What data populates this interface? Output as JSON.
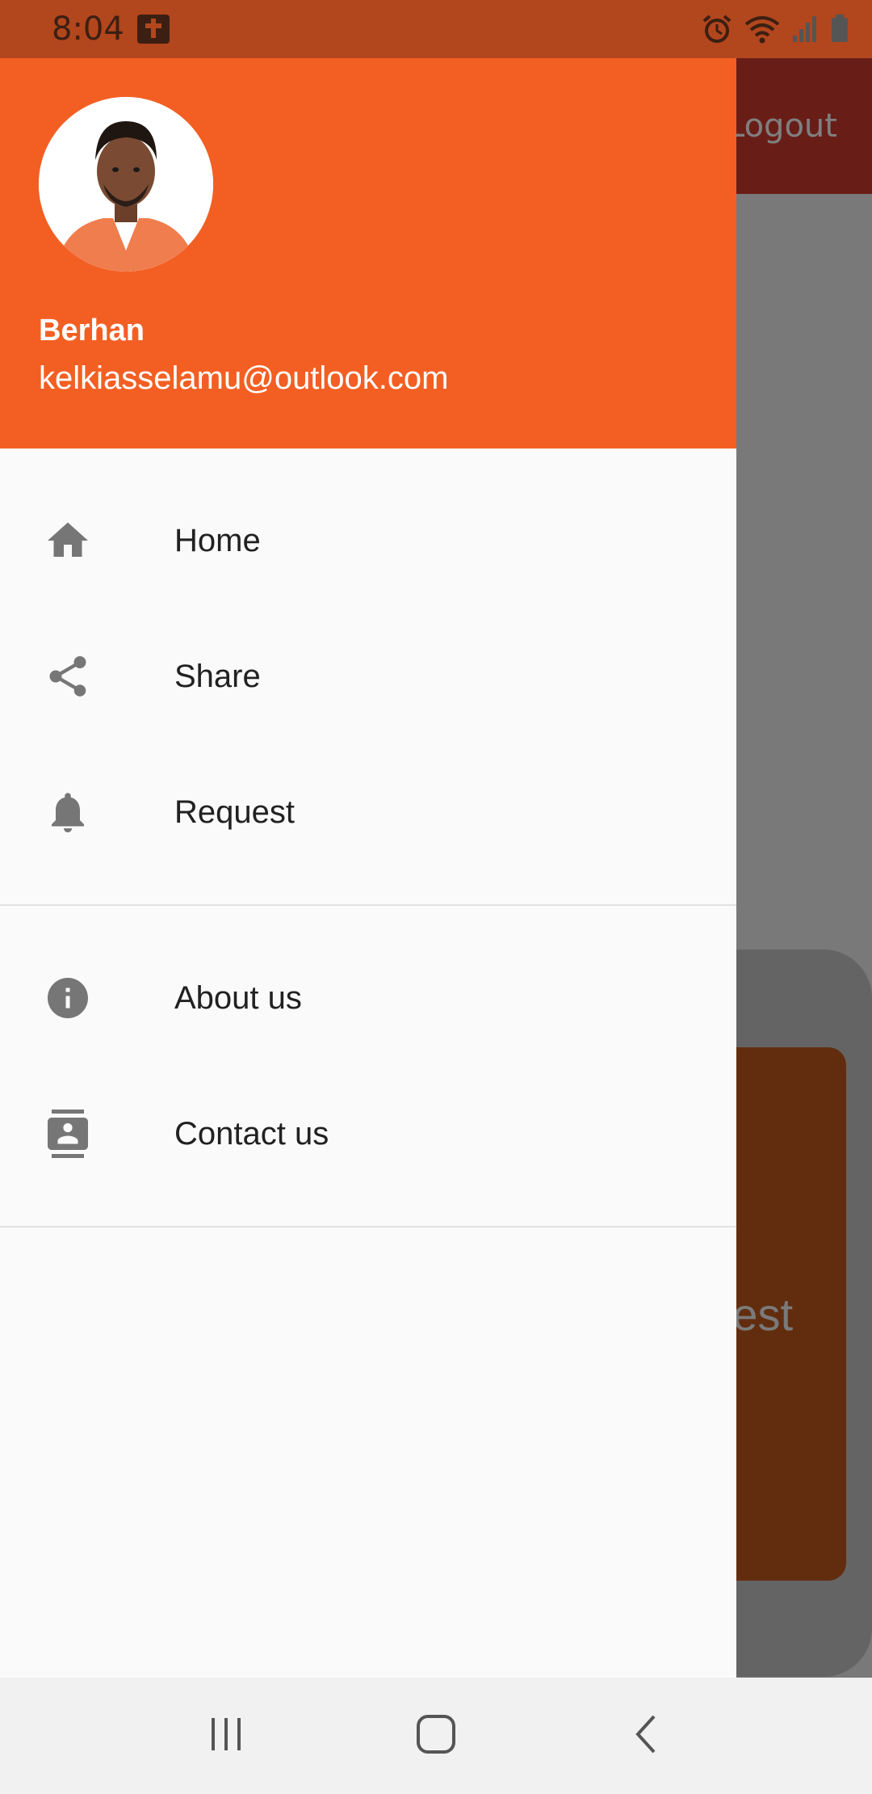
{
  "status_bar": {
    "time": "8:04",
    "icons": [
      "bible-app-icon",
      "alarm-icon",
      "wifi-icon",
      "signal-icon",
      "battery-icon"
    ]
  },
  "background": {
    "logout_label": "Logout",
    "card_partial_text": "est"
  },
  "drawer": {
    "header": {
      "name": "Berhan",
      "email": "kelkiasselamu@outlook.com",
      "background_color": "#f35f23"
    },
    "groups": [
      {
        "items": [
          {
            "label": "Home",
            "icon": "home-icon"
          },
          {
            "label": "Share",
            "icon": "share-icon"
          },
          {
            "label": "Request",
            "icon": "bell-icon"
          }
        ]
      },
      {
        "items": [
          {
            "label": "About us",
            "icon": "info-icon"
          },
          {
            "label": "Contact us",
            "icon": "contact-card-icon"
          }
        ]
      }
    ]
  },
  "nav_bar": {
    "buttons": [
      "recents-icon",
      "home-button-icon",
      "back-icon"
    ]
  },
  "colors": {
    "accent": "#f35f23",
    "icon_gray": "#767676",
    "logout_red": "#d23a2e"
  }
}
